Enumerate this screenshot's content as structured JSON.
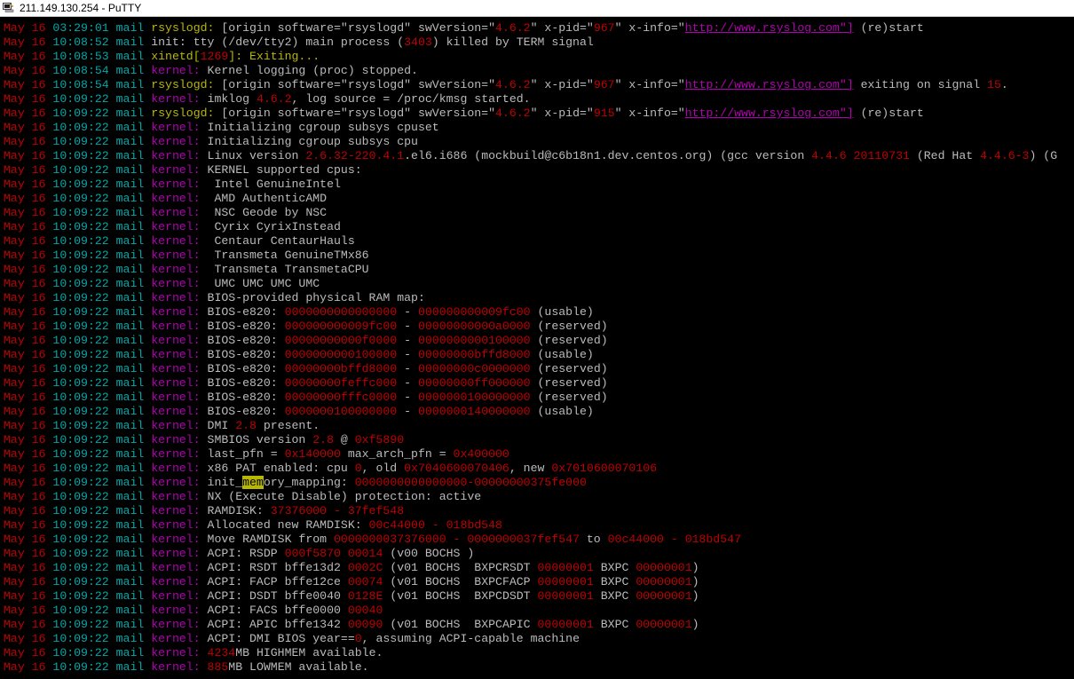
{
  "window": {
    "title": "211.149.130.254 - PuTTY",
    "icon": "putty-icon"
  },
  "colors": {
    "date": "#c00000",
    "time": "#00a8a8",
    "host": "#00a8a8",
    "proc_yellow": "#b8b800",
    "kernel": "#b000b0",
    "number": "#c00000",
    "text": "#bbbbbb",
    "highlight_bg": "#b8b800",
    "background": "#000000"
  },
  "log": [
    {
      "date": "May 16",
      "time": "03:29:01",
      "host": "mail",
      "proc": "rsyslogd:",
      "pc": "proc",
      "segs": [
        {
          "t": " [origin software=\"rsyslogd\" swVersion=\""
        },
        {
          "t": "4.6.2",
          "c": "n"
        },
        {
          "t": "\" x-pid=\""
        },
        {
          "t": "967",
          "c": "n"
        },
        {
          "t": "\" x-info=\""
        },
        {
          "t": "http://www.rsyslog.com\"]",
          "c": "url"
        },
        {
          "t": " (re)start"
        }
      ]
    },
    {
      "date": "May 16",
      "time": "10:08:52",
      "host": "mail",
      "proc": "init:",
      "pc": "init",
      "segs": [
        {
          "t": " tty (/dev/tty2) main process ("
        },
        {
          "t": "3403",
          "c": "n"
        },
        {
          "t": ") killed by TERM signal"
        }
      ]
    },
    {
      "date": "May 16",
      "time": "10:08:53",
      "host": "mail",
      "proc": "xinetd[",
      "pc": "proc",
      "segs": [
        {
          "t": "1269",
          "c": "n"
        },
        {
          "t": "]: Exiting...",
          "c": "proc2"
        }
      ]
    },
    {
      "date": "May 16",
      "time": "10:08:54",
      "host": "mail",
      "proc": "kernel:",
      "pc": "kernel",
      "segs": [
        {
          "t": " Kernel logging (proc) stopped."
        }
      ]
    },
    {
      "date": "May 16",
      "time": "10:08:54",
      "host": "mail",
      "proc": "rsyslogd:",
      "pc": "proc",
      "segs": [
        {
          "t": " [origin software=\"rsyslogd\" swVersion=\""
        },
        {
          "t": "4.6.2",
          "c": "n"
        },
        {
          "t": "\" x-pid=\""
        },
        {
          "t": "967",
          "c": "n"
        },
        {
          "t": "\" x-info=\""
        },
        {
          "t": "http://www.rsyslog.com\"]",
          "c": "url"
        },
        {
          "t": " exiting on signal "
        },
        {
          "t": "15",
          "c": "n"
        },
        {
          "t": "."
        }
      ]
    },
    {
      "date": "May 16",
      "time": "10:09:22",
      "host": "mail",
      "proc": "kernel:",
      "pc": "kernel",
      "segs": [
        {
          "t": " imklog "
        },
        {
          "t": "4.6.2",
          "c": "n"
        },
        {
          "t": ", log source = /proc/kmsg started."
        }
      ]
    },
    {
      "date": "May 16",
      "time": "10:09:22",
      "host": "mail",
      "proc": "rsyslogd:",
      "pc": "proc",
      "segs": [
        {
          "t": " [origin software=\"rsyslogd\" swVersion=\""
        },
        {
          "t": "4.6.2",
          "c": "n"
        },
        {
          "t": "\" x-pid=\""
        },
        {
          "t": "915",
          "c": "n"
        },
        {
          "t": "\" x-info=\""
        },
        {
          "t": "http://www.rsyslog.com\"]",
          "c": "url"
        },
        {
          "t": " (re)start"
        }
      ]
    },
    {
      "date": "May 16",
      "time": "10:09:22",
      "host": "mail",
      "proc": "kernel:",
      "pc": "kernel",
      "segs": [
        {
          "t": " Initializing cgroup subsys cpuset"
        }
      ]
    },
    {
      "date": "May 16",
      "time": "10:09:22",
      "host": "mail",
      "proc": "kernel:",
      "pc": "kernel",
      "segs": [
        {
          "t": " Initializing cgroup subsys cpu"
        }
      ]
    },
    {
      "date": "May 16",
      "time": "10:09:22",
      "host": "mail",
      "proc": "kernel:",
      "pc": "kernel",
      "segs": [
        {
          "t": " Linux version "
        },
        {
          "t": "2.6.32-220.4.1",
          "c": "n"
        },
        {
          "t": ".el6.i686 (mockbuild@c6b18n1.dev.centos.org) (gcc version "
        },
        {
          "t": "4.4.6 20110731",
          "c": "n"
        },
        {
          "t": " (Red Hat "
        },
        {
          "t": "4.4.6-3",
          "c": "n"
        },
        {
          "t": ") (G"
        }
      ]
    },
    {
      "date": "May 16",
      "time": "10:09:22",
      "host": "mail",
      "proc": "kernel:",
      "pc": "kernel",
      "segs": [
        {
          "t": " KERNEL supported cpus:"
        }
      ]
    },
    {
      "date": "May 16",
      "time": "10:09:22",
      "host": "mail",
      "proc": "kernel:",
      "pc": "kernel",
      "segs": [
        {
          "t": "  Intel GenuineIntel"
        }
      ]
    },
    {
      "date": "May 16",
      "time": "10:09:22",
      "host": "mail",
      "proc": "kernel:",
      "pc": "kernel",
      "segs": [
        {
          "t": "  AMD AuthenticAMD"
        }
      ]
    },
    {
      "date": "May 16",
      "time": "10:09:22",
      "host": "mail",
      "proc": "kernel:",
      "pc": "kernel",
      "segs": [
        {
          "t": "  NSC Geode by NSC"
        }
      ]
    },
    {
      "date": "May 16",
      "time": "10:09:22",
      "host": "mail",
      "proc": "kernel:",
      "pc": "kernel",
      "segs": [
        {
          "t": "  Cyrix CyrixInstead"
        }
      ]
    },
    {
      "date": "May 16",
      "time": "10:09:22",
      "host": "mail",
      "proc": "kernel:",
      "pc": "kernel",
      "segs": [
        {
          "t": "  Centaur CentaurHauls"
        }
      ]
    },
    {
      "date": "May 16",
      "time": "10:09:22",
      "host": "mail",
      "proc": "kernel:",
      "pc": "kernel",
      "segs": [
        {
          "t": "  Transmeta GenuineTMx86"
        }
      ]
    },
    {
      "date": "May 16",
      "time": "10:09:22",
      "host": "mail",
      "proc": "kernel:",
      "pc": "kernel",
      "segs": [
        {
          "t": "  Transmeta TransmetaCPU"
        }
      ]
    },
    {
      "date": "May 16",
      "time": "10:09:22",
      "host": "mail",
      "proc": "kernel:",
      "pc": "kernel",
      "segs": [
        {
          "t": "  UMC UMC UMC UMC"
        }
      ]
    },
    {
      "date": "May 16",
      "time": "10:09:22",
      "host": "mail",
      "proc": "kernel:",
      "pc": "kernel",
      "segs": [
        {
          "t": " BIOS-provided physical RAM map:"
        }
      ]
    },
    {
      "date": "May 16",
      "time": "10:09:22",
      "host": "mail",
      "proc": "kernel:",
      "pc": "kernel",
      "segs": [
        {
          "t": " BIOS-e820: "
        },
        {
          "t": "0000000000000000",
          "c": "n"
        },
        {
          "t": " - "
        },
        {
          "t": "000000000009fc00",
          "c": "n"
        },
        {
          "t": " (usable)"
        }
      ]
    },
    {
      "date": "May 16",
      "time": "10:09:22",
      "host": "mail",
      "proc": "kernel:",
      "pc": "kernel",
      "segs": [
        {
          "t": " BIOS-e820: "
        },
        {
          "t": "000000000009fc00",
          "c": "n"
        },
        {
          "t": " - "
        },
        {
          "t": "00000000000a0000",
          "c": "n"
        },
        {
          "t": " (reserved)"
        }
      ]
    },
    {
      "date": "May 16",
      "time": "10:09:22",
      "host": "mail",
      "proc": "kernel:",
      "pc": "kernel",
      "segs": [
        {
          "t": " BIOS-e820: "
        },
        {
          "t": "00000000000f0000",
          "c": "n"
        },
        {
          "t": " - "
        },
        {
          "t": "0000000000100000",
          "c": "n"
        },
        {
          "t": " (reserved)"
        }
      ]
    },
    {
      "date": "May 16",
      "time": "10:09:22",
      "host": "mail",
      "proc": "kernel:",
      "pc": "kernel",
      "segs": [
        {
          "t": " BIOS-e820: "
        },
        {
          "t": "0000000000100000",
          "c": "n"
        },
        {
          "t": " - "
        },
        {
          "t": "00000000bffd8000",
          "c": "n"
        },
        {
          "t": " (usable)"
        }
      ]
    },
    {
      "date": "May 16",
      "time": "10:09:22",
      "host": "mail",
      "proc": "kernel:",
      "pc": "kernel",
      "segs": [
        {
          "t": " BIOS-e820: "
        },
        {
          "t": "00000000bffd8000",
          "c": "n"
        },
        {
          "t": " - "
        },
        {
          "t": "00000000c0000000",
          "c": "n"
        },
        {
          "t": " (reserved)"
        }
      ]
    },
    {
      "date": "May 16",
      "time": "10:09:22",
      "host": "mail",
      "proc": "kernel:",
      "pc": "kernel",
      "segs": [
        {
          "t": " BIOS-e820: "
        },
        {
          "t": "00000000feffc000",
          "c": "n"
        },
        {
          "t": " - "
        },
        {
          "t": "00000000ff000000",
          "c": "n"
        },
        {
          "t": " (reserved)"
        }
      ]
    },
    {
      "date": "May 16",
      "time": "10:09:22",
      "host": "mail",
      "proc": "kernel:",
      "pc": "kernel",
      "segs": [
        {
          "t": " BIOS-e820: "
        },
        {
          "t": "00000000fffc0000",
          "c": "n"
        },
        {
          "t": " - "
        },
        {
          "t": "0000000100000000",
          "c": "n"
        },
        {
          "t": " (reserved)"
        }
      ]
    },
    {
      "date": "May 16",
      "time": "10:09:22",
      "host": "mail",
      "proc": "kernel:",
      "pc": "kernel",
      "segs": [
        {
          "t": " BIOS-e820: "
        },
        {
          "t": "0000000100000000",
          "c": "n"
        },
        {
          "t": " - "
        },
        {
          "t": "0000000140000000",
          "c": "n"
        },
        {
          "t": " (usable)"
        }
      ]
    },
    {
      "date": "May 16",
      "time": "10:09:22",
      "host": "mail",
      "proc": "kernel:",
      "pc": "kernel",
      "segs": [
        {
          "t": " DMI "
        },
        {
          "t": "2.8",
          "c": "n"
        },
        {
          "t": " present."
        }
      ]
    },
    {
      "date": "May 16",
      "time": "10:09:22",
      "host": "mail",
      "proc": "kernel:",
      "pc": "kernel",
      "segs": [
        {
          "t": " SMBIOS version "
        },
        {
          "t": "2.8",
          "c": "n"
        },
        {
          "t": " @ "
        },
        {
          "t": "0xf5890",
          "c": "n"
        }
      ]
    },
    {
      "date": "May 16",
      "time": "10:09:22",
      "host": "mail",
      "proc": "kernel:",
      "pc": "kernel",
      "segs": [
        {
          "t": " last_pfn = "
        },
        {
          "t": "0x140000",
          "c": "n"
        },
        {
          "t": " max_arch_pfn = "
        },
        {
          "t": "0x400000",
          "c": "n"
        }
      ]
    },
    {
      "date": "May 16",
      "time": "10:09:22",
      "host": "mail",
      "proc": "kernel:",
      "pc": "kernel",
      "segs": [
        {
          "t": " x86 PAT enabled: cpu "
        },
        {
          "t": "0",
          "c": "n"
        },
        {
          "t": ", old "
        },
        {
          "t": "0x7040600070406",
          "c": "n"
        },
        {
          "t": ", new "
        },
        {
          "t": "0x7010600070106",
          "c": "n"
        }
      ]
    },
    {
      "date": "May 16",
      "time": "10:09:22",
      "host": "mail",
      "proc": "kernel:",
      "pc": "kernel",
      "segs": [
        {
          "t": " init_"
        },
        {
          "t": "mem",
          "c": "hl"
        },
        {
          "t": "ory_mapping: "
        },
        {
          "t": "0000000000000000-00000000375fe000",
          "c": "n"
        }
      ]
    },
    {
      "date": "May 16",
      "time": "10:09:22",
      "host": "mail",
      "proc": "kernel:",
      "pc": "kernel",
      "segs": [
        {
          "t": " NX (Execute Disable) protection: active"
        }
      ]
    },
    {
      "date": "May 16",
      "time": "10:09:22",
      "host": "mail",
      "proc": "kernel:",
      "pc": "kernel",
      "segs": [
        {
          "t": " RAMDISK: "
        },
        {
          "t": "37376000 - 37fef548",
          "c": "n"
        }
      ]
    },
    {
      "date": "May 16",
      "time": "10:09:22",
      "host": "mail",
      "proc": "kernel:",
      "pc": "kernel",
      "segs": [
        {
          "t": " Allocated new RAMDISK: "
        },
        {
          "t": "00c44000 - 018bd548",
          "c": "n"
        }
      ]
    },
    {
      "date": "May 16",
      "time": "10:09:22",
      "host": "mail",
      "proc": "kernel:",
      "pc": "kernel",
      "segs": [
        {
          "t": " Move RAMDISK from "
        },
        {
          "t": "0000000037376000 - 0000000037fef547",
          "c": "n"
        },
        {
          "t": " to "
        },
        {
          "t": "00c44000 - 018bd547",
          "c": "n"
        }
      ]
    },
    {
      "date": "May 16",
      "time": "10:09:22",
      "host": "mail",
      "proc": "kernel:",
      "pc": "kernel",
      "segs": [
        {
          "t": " ACPI: RSDP "
        },
        {
          "t": "000f5870 00014",
          "c": "n"
        },
        {
          "t": " (v00 BOCHS )"
        }
      ]
    },
    {
      "date": "May 16",
      "time": "10:09:22",
      "host": "mail",
      "proc": "kernel:",
      "pc": "kernel",
      "segs": [
        {
          "t": " ACPI: RSDT bffe13d2 "
        },
        {
          "t": "0002C",
          "c": "n"
        },
        {
          "t": " (v01 BOCHS  BXPCRSDT "
        },
        {
          "t": "00000001",
          "c": "n"
        },
        {
          "t": " BXPC "
        },
        {
          "t": "00000001",
          "c": "n"
        },
        {
          "t": ")"
        }
      ]
    },
    {
      "date": "May 16",
      "time": "10:09:22",
      "host": "mail",
      "proc": "kernel:",
      "pc": "kernel",
      "segs": [
        {
          "t": " ACPI: FACP bffe12ce "
        },
        {
          "t": "00074",
          "c": "n"
        },
        {
          "t": " (v01 BOCHS  BXPCFACP "
        },
        {
          "t": "00000001",
          "c": "n"
        },
        {
          "t": " BXPC "
        },
        {
          "t": "00000001",
          "c": "n"
        },
        {
          "t": ")"
        }
      ]
    },
    {
      "date": "May 16",
      "time": "10:09:22",
      "host": "mail",
      "proc": "kernel:",
      "pc": "kernel",
      "segs": [
        {
          "t": " ACPI: DSDT bffe0040 "
        },
        {
          "t": "0128E",
          "c": "n"
        },
        {
          "t": " (v01 BOCHS  BXPCDSDT "
        },
        {
          "t": "00000001",
          "c": "n"
        },
        {
          "t": " BXPC "
        },
        {
          "t": "00000001",
          "c": "n"
        },
        {
          "t": ")"
        }
      ]
    },
    {
      "date": "May 16",
      "time": "10:09:22",
      "host": "mail",
      "proc": "kernel:",
      "pc": "kernel",
      "segs": [
        {
          "t": " ACPI: FACS bffe0000 "
        },
        {
          "t": "00040",
          "c": "n"
        }
      ]
    },
    {
      "date": "May 16",
      "time": "10:09:22",
      "host": "mail",
      "proc": "kernel:",
      "pc": "kernel",
      "segs": [
        {
          "t": " ACPI: APIC bffe1342 "
        },
        {
          "t": "00090",
          "c": "n"
        },
        {
          "t": " (v01 BOCHS  BXPCAPIC "
        },
        {
          "t": "00000001",
          "c": "n"
        },
        {
          "t": " BXPC "
        },
        {
          "t": "00000001",
          "c": "n"
        },
        {
          "t": ")"
        }
      ]
    },
    {
      "date": "May 16",
      "time": "10:09:22",
      "host": "mail",
      "proc": "kernel:",
      "pc": "kernel",
      "segs": [
        {
          "t": " ACPI: DMI BIOS year=="
        },
        {
          "t": "0",
          "c": "n"
        },
        {
          "t": ", assuming ACPI-capable machine"
        }
      ]
    },
    {
      "date": "May 16",
      "time": "10:09:22",
      "host": "mail",
      "proc": "kernel:",
      "pc": "kernel",
      "segs": [
        {
          "t": " "
        },
        {
          "t": "4234",
          "c": "n"
        },
        {
          "t": "MB HIGHMEM available."
        }
      ]
    },
    {
      "date": "May 16",
      "time": "10:09:22",
      "host": "mail",
      "proc": "kernel:",
      "pc": "kernel",
      "segs": [
        {
          "t": " "
        },
        {
          "t": "885",
          "c": "n"
        },
        {
          "t": "MB LOWMEM available."
        }
      ]
    }
  ]
}
